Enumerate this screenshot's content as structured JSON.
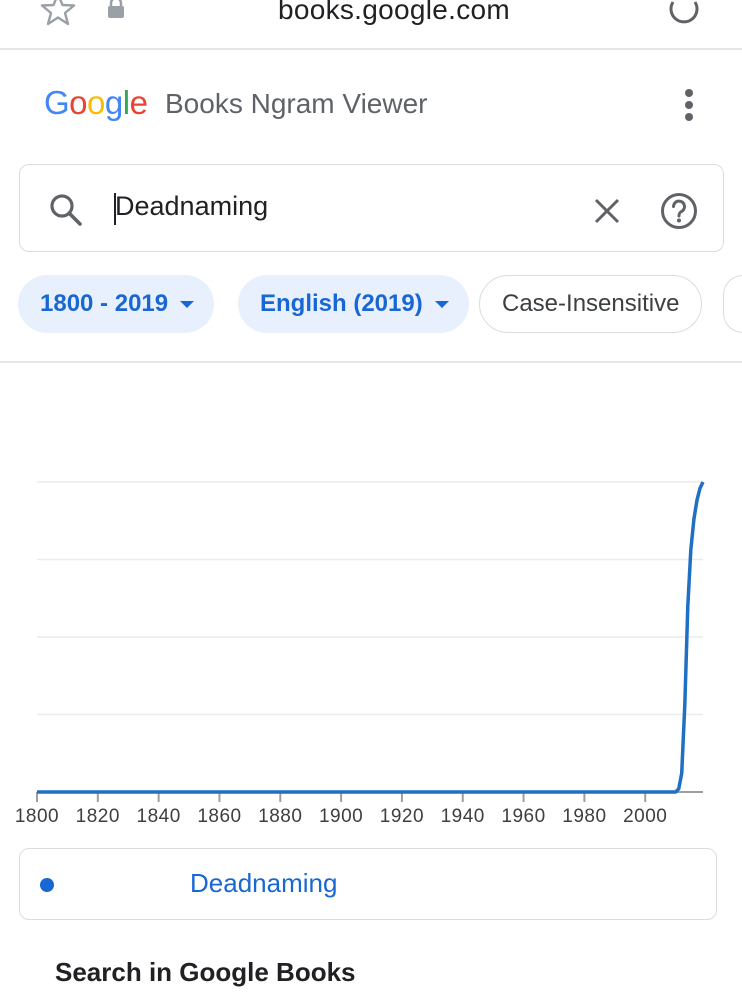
{
  "browser": {
    "url": "books.google.com",
    "icons": [
      "star-icon",
      "lock-icon",
      "reload-icon"
    ]
  },
  "header": {
    "logo_text": "Google",
    "title": "Books Ngram Viewer",
    "menu_icon": "more-vert-icon"
  },
  "search": {
    "value": "Deadnaming",
    "icons": [
      "search-icon",
      "clear-icon",
      "help-icon"
    ]
  },
  "filters": {
    "years": "1800 - 2019",
    "corpus": "English (2019)",
    "case": "Case-Insensitive"
  },
  "colors": {
    "accent": "#1967d2",
    "line": "#1f6fc3",
    "chip_bg": "#e8f0fe"
  },
  "chart_data": {
    "type": "line",
    "title": "",
    "xlabel": "",
    "ylabel": "",
    "xlim": [
      1800,
      2019
    ],
    "x_ticks": [
      1800,
      1820,
      1840,
      1860,
      1880,
      1900,
      1920,
      1940,
      1960,
      1980,
      2000
    ],
    "y_ticks_labeled": false,
    "grid": "horizontal",
    "series": [
      {
        "name": "Deadnaming",
        "x": [
          1800,
          1900,
          2000,
          2010,
          2011,
          2012,
          2013,
          2014,
          2015,
          2016,
          2017,
          2018,
          2019
        ],
        "values": [
          0,
          0,
          0,
          0,
          0.01,
          0.06,
          0.28,
          0.6,
          0.78,
          0.88,
          0.94,
          0.98,
          1.0
        ]
      }
    ]
  },
  "legend": {
    "entries": [
      {
        "label": "Deadnaming"
      }
    ]
  },
  "sections": {
    "search_books_title": "Search in Google Books"
  }
}
